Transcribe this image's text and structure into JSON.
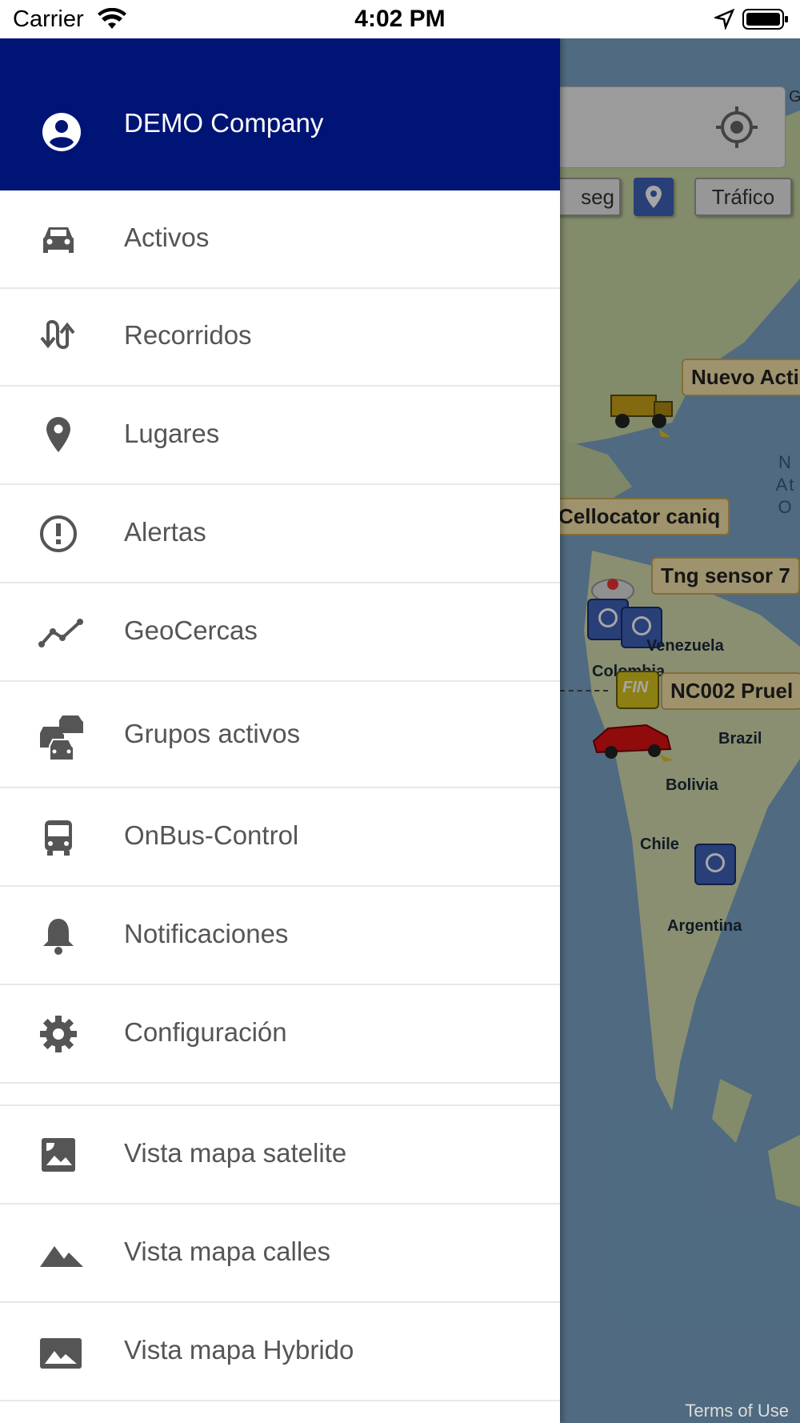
{
  "status_bar": {
    "carrier": "Carrier",
    "time": "4:02 PM"
  },
  "drawer": {
    "company": "DEMO Company",
    "items": [
      {
        "label": "Activos",
        "icon": "car-icon"
      },
      {
        "label": "Recorridos",
        "icon": "swap-vertical-icon"
      },
      {
        "label": "Lugares",
        "icon": "place-pin-icon"
      },
      {
        "label": "Alertas",
        "icon": "alert-circle-icon"
      },
      {
        "label": "GeoCercas",
        "icon": "trending-line-icon"
      },
      {
        "label": "Grupos activos",
        "icon": "multiple-cars-icon"
      },
      {
        "label": "OnBus-Control",
        "icon": "bus-icon"
      },
      {
        "label": "Notificaciones",
        "icon": "bell-icon"
      },
      {
        "label": "Configuración",
        "icon": "gear-icon"
      }
    ],
    "map_views": [
      {
        "label": "Vista mapa satelite",
        "icon": "satellite-image-icon"
      },
      {
        "label": "Vista mapa calles",
        "icon": "terrain-icon"
      },
      {
        "label": "Vista mapa Hybrido",
        "icon": "landscape-image-icon"
      }
    ]
  },
  "map": {
    "buttons": {
      "seg": "seg",
      "traffic": "Tráfico"
    },
    "labels": {
      "tag1": "Nuevo Acti",
      "tag2": "Cellocator caniq",
      "tag3": "Tng sensor 7",
      "tag4": "NC002 Pruel",
      "fin": "FIN",
      "country1": "Venezuela",
      "country2": "Colombia",
      "country3": "Brazil",
      "country4": "Bolivia",
      "country5": "Chile",
      "country6": "Argentina",
      "ocean": "N\nAt\nO",
      "edge_letter": "G"
    },
    "terms": "Terms of Use",
    "colors": {
      "sea": "#7aa4c7",
      "land": "#c8d6a4",
      "drawer_header": "#001475"
    }
  }
}
